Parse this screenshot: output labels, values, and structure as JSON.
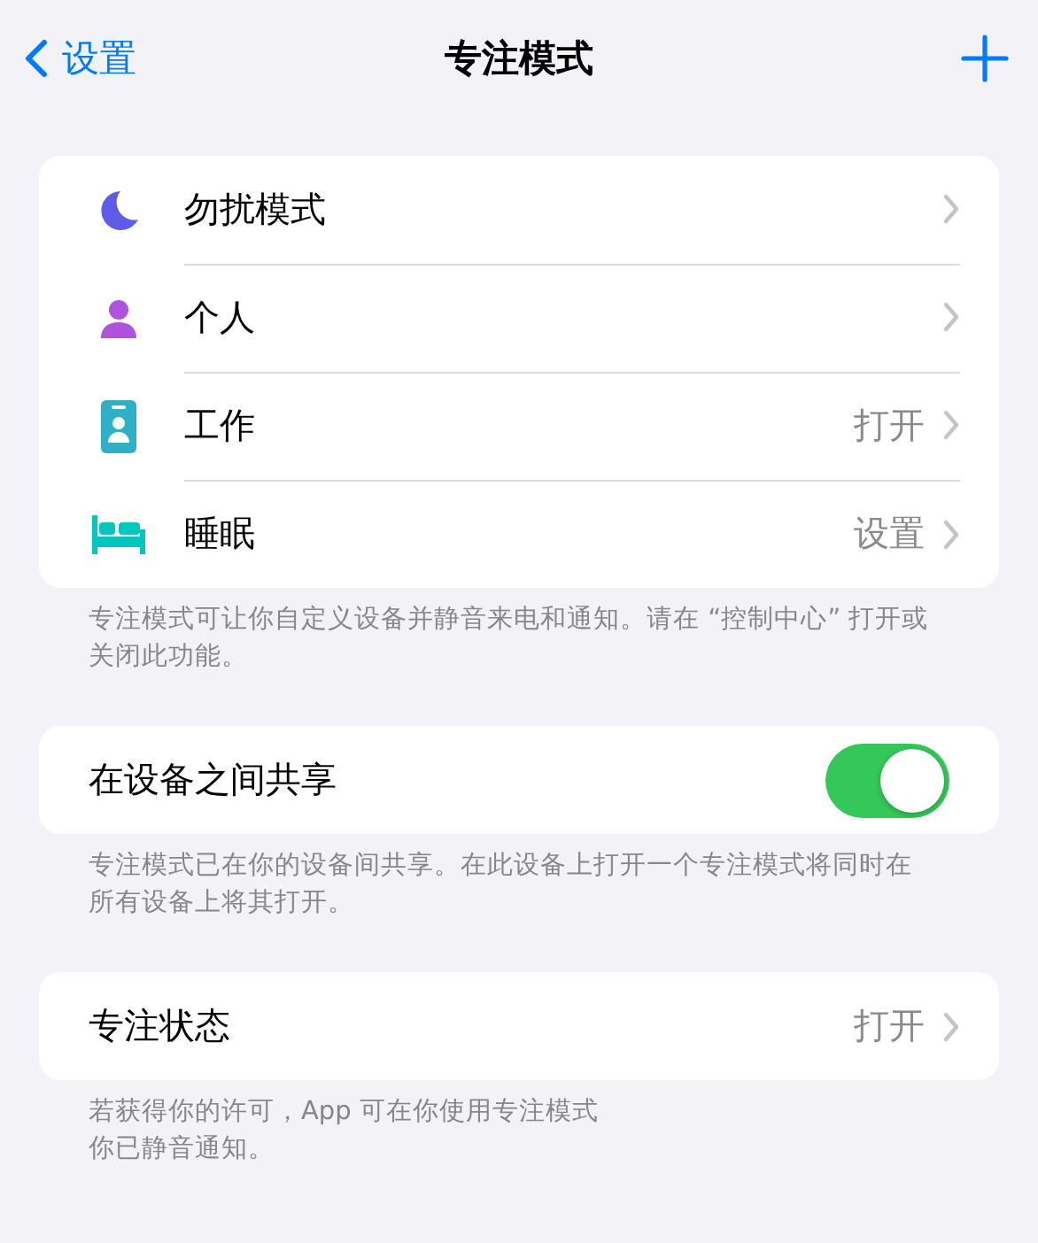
{
  "nav": {
    "back": "设置",
    "title": "专注模式"
  },
  "focus_modes": [
    {
      "kind": "moon",
      "label": "勿扰模式"
    },
    {
      "kind": "person",
      "label": "个人"
    },
    {
      "kind": "badge",
      "label": "工作",
      "value": "打开"
    },
    {
      "kind": "bed",
      "label": "睡眠",
      "value": "设置"
    }
  ],
  "focus_footer": "专注模式可让你自定义设备并静音来电和通知。请在 “控制中心” 打开或关闭此功能。",
  "share": {
    "label": "在设备之间共享",
    "on": true
  },
  "share_footer": "专注模式已在你的设备间共享。在此设备上打开一个专注模式将同时在所有设备上将其打开。",
  "status": {
    "label": "专注状态",
    "value": "打开"
  },
  "status_footer": [
    "若获得你的许可，App 可在你使用专注模式",
    "你已静音通知。"
  ]
}
